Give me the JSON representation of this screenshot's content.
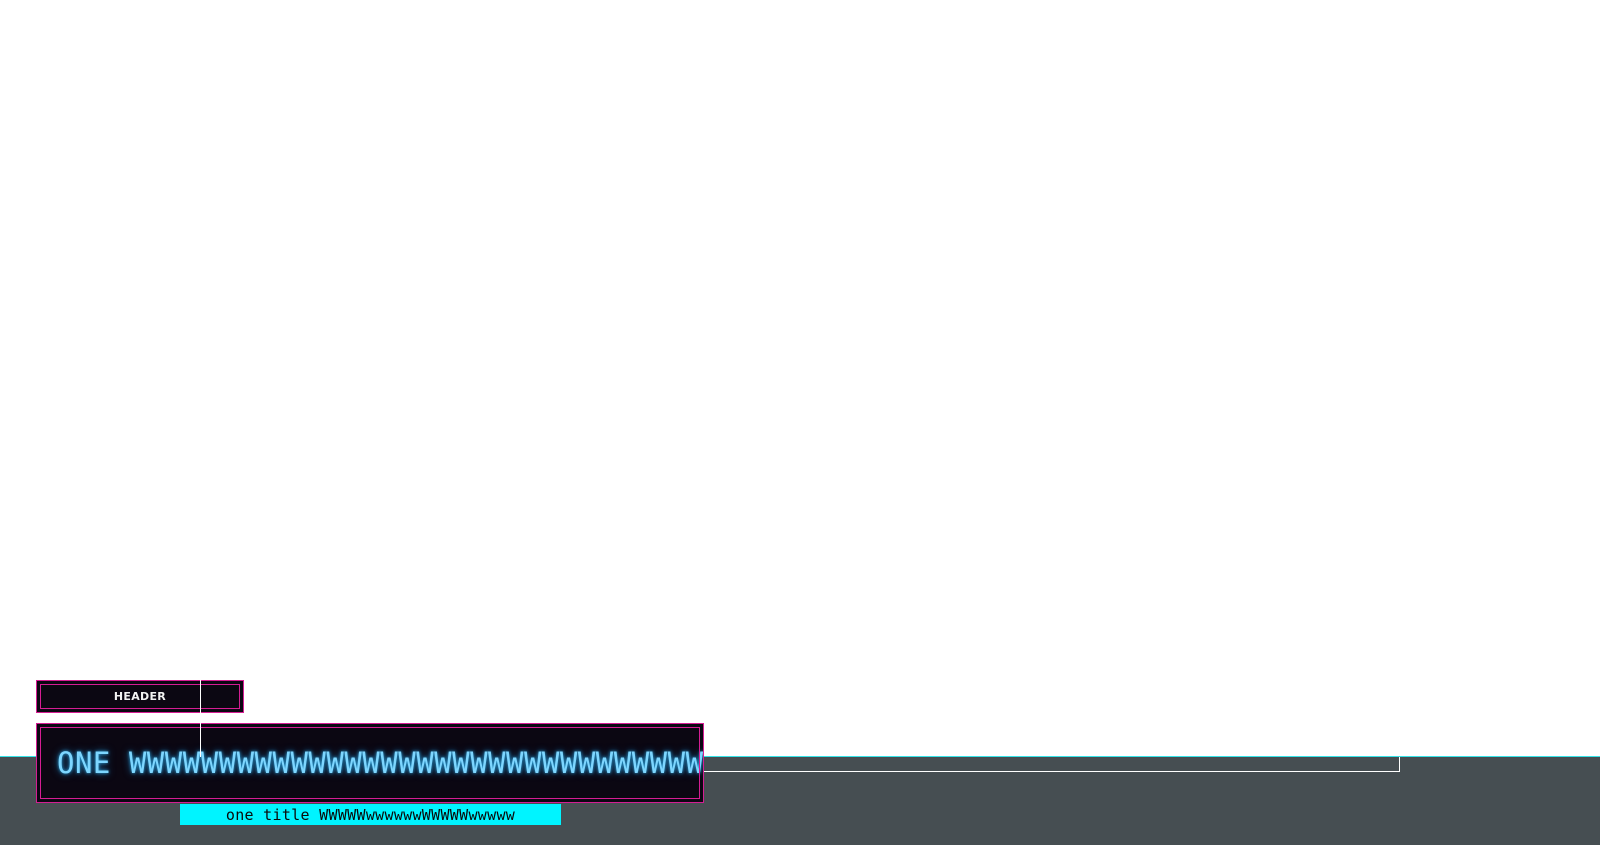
{
  "header": {
    "label": "HEADER"
  },
  "title": {
    "text": "ONE WWWWWWWWWWWWWWWWWWWWWWWWWWWWWWWW"
  },
  "subtitle": {
    "text": "one title WWWWWwwwwwwWWWWWwwwww"
  },
  "colors": {
    "panel_background": "#0b0712",
    "panel_border": "#d51d93",
    "title_text": "#7dd6ff",
    "subtitle_background": "#00f4ff",
    "bottom_band": "#464e52",
    "band_edge": "#34e3e8"
  }
}
